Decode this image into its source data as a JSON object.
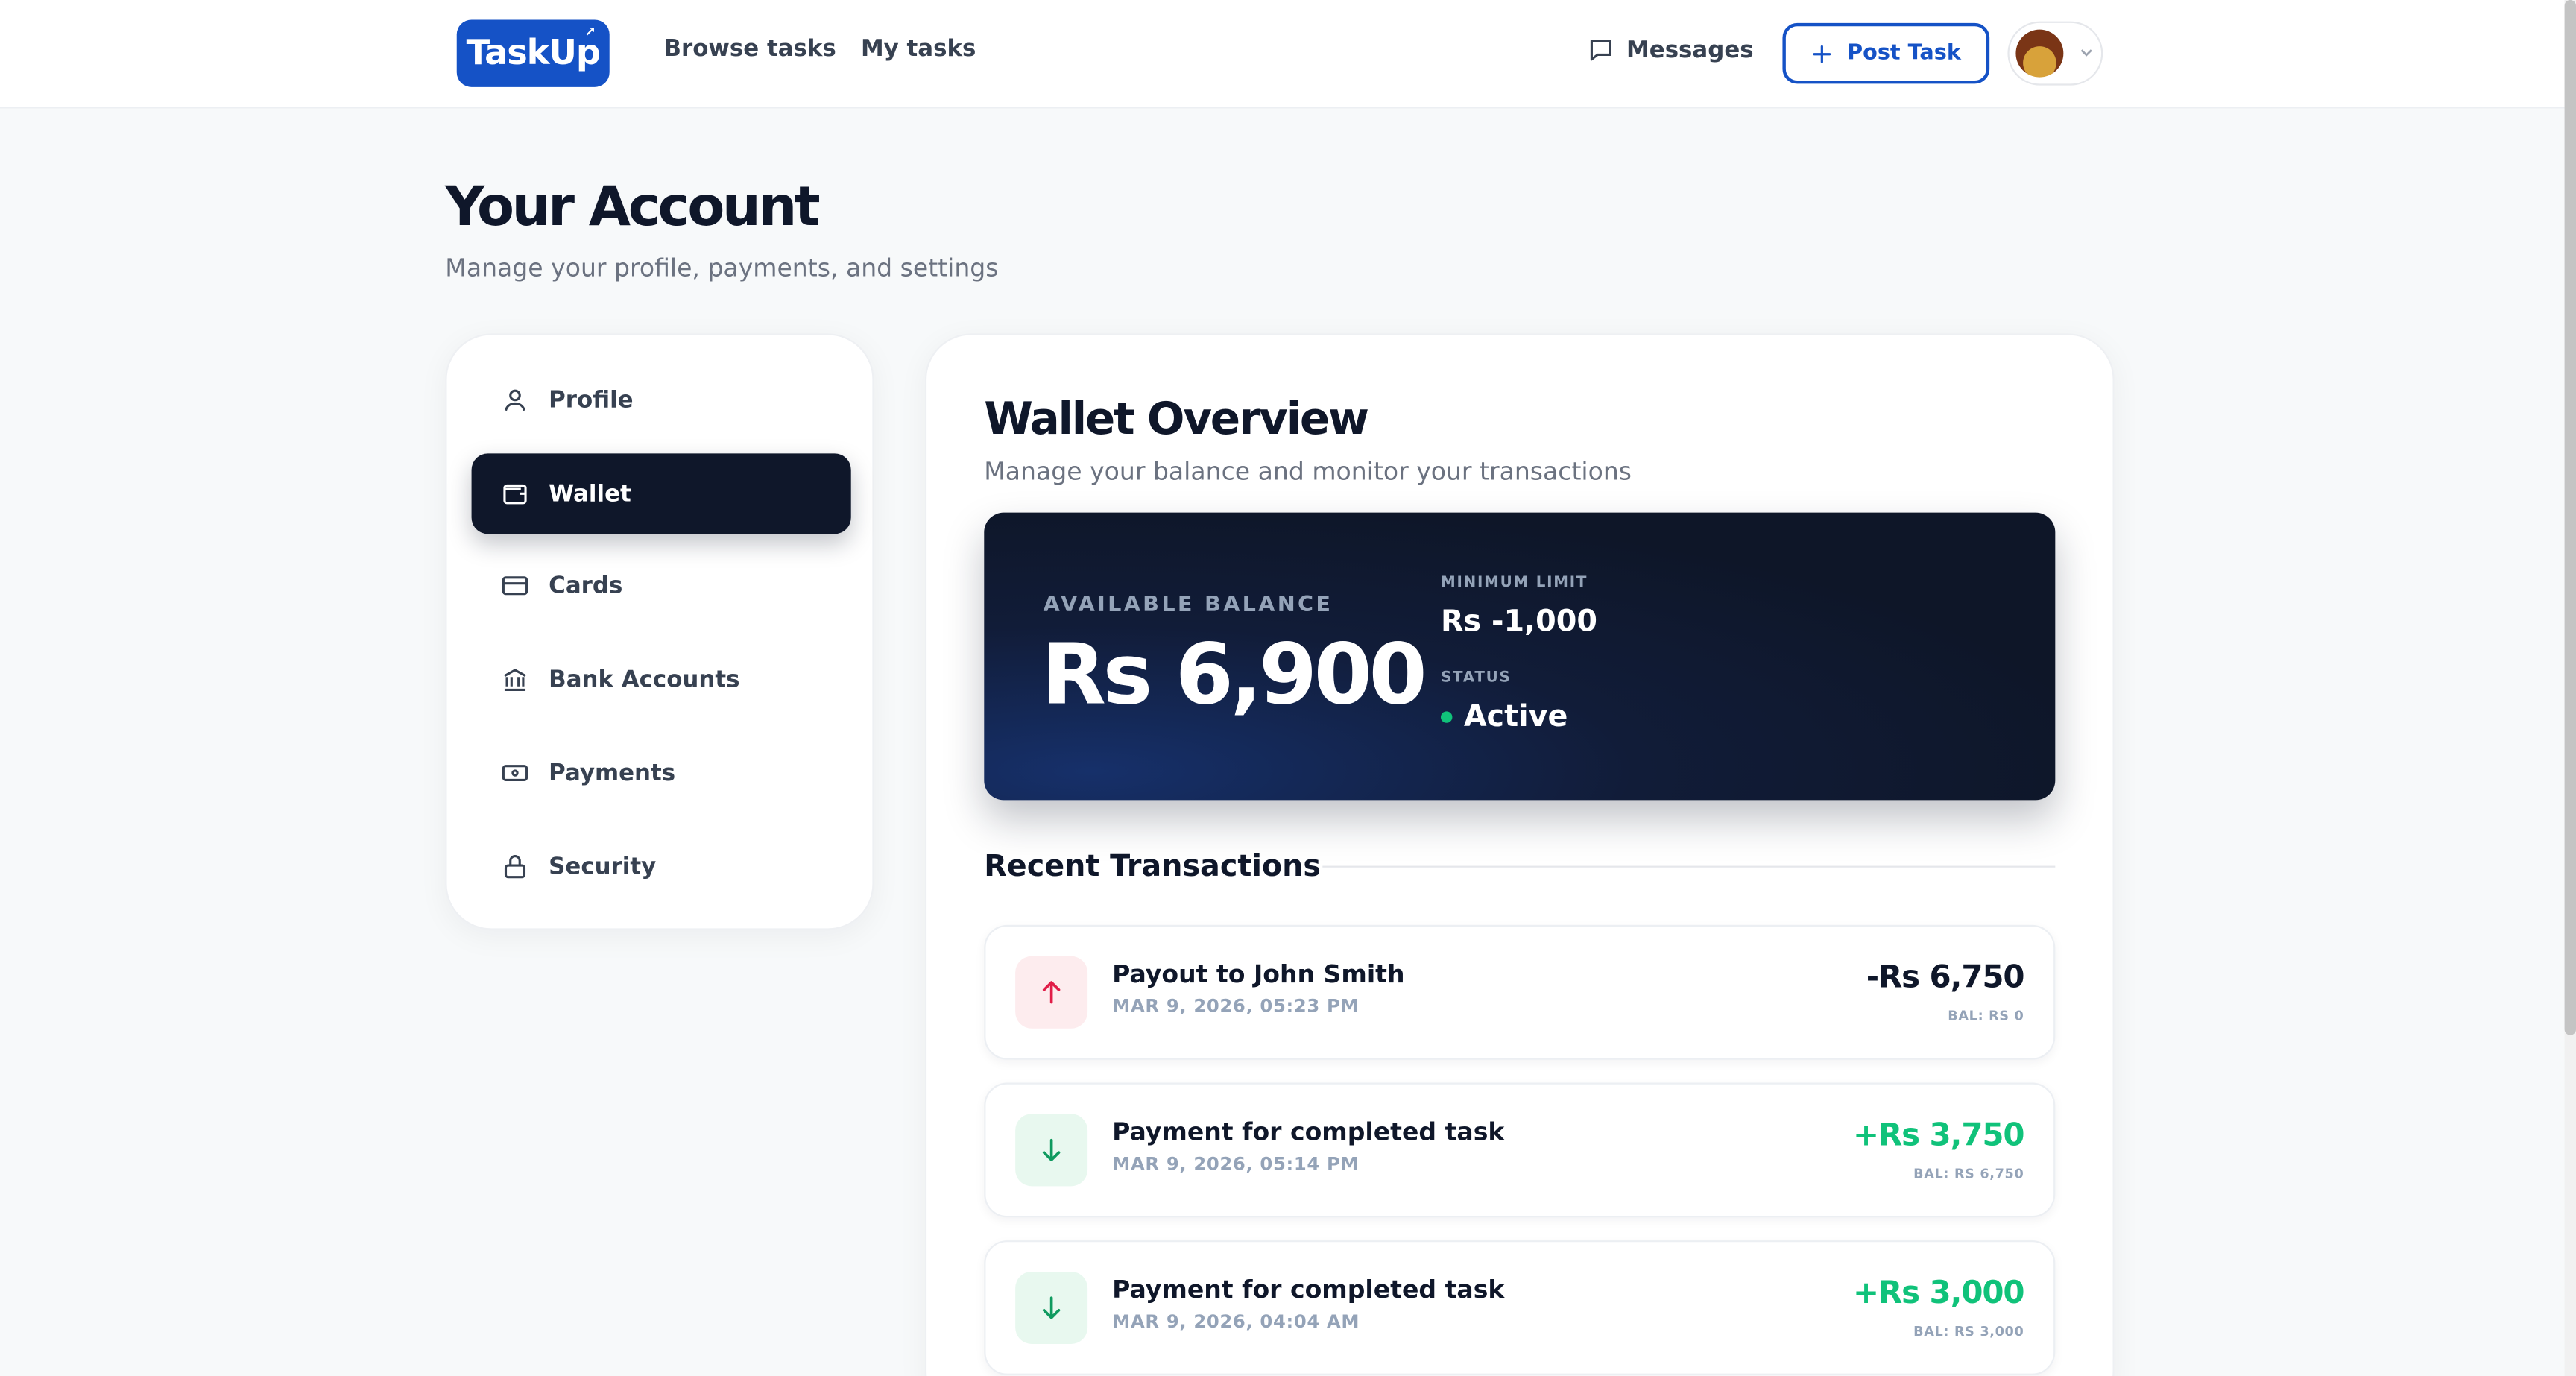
{
  "header": {
    "logo_text": "TaskUp",
    "nav": [
      "Browse tasks",
      "My tasks"
    ],
    "messages_label": "Messages",
    "post_task_label": "Post Task"
  },
  "page": {
    "title": "Your Account",
    "subtitle": "Manage your profile, payments, and settings"
  },
  "sidebar": {
    "items": [
      {
        "label": "Profile",
        "icon": "user-icon",
        "active": false
      },
      {
        "label": "Wallet",
        "icon": "wallet-icon",
        "active": true
      },
      {
        "label": "Cards",
        "icon": "card-icon",
        "active": false
      },
      {
        "label": "Bank Accounts",
        "icon": "bank-icon",
        "active": false
      },
      {
        "label": "Payments",
        "icon": "banknote-icon",
        "active": false
      },
      {
        "label": "Security",
        "icon": "lock-icon",
        "active": false
      }
    ]
  },
  "wallet": {
    "title": "Wallet Overview",
    "subtitle": "Manage your balance and monitor your transactions",
    "balance_label": "AVAILABLE BALANCE",
    "balance_value": "Rs 6,900",
    "min_limit_label": "MINIMUM LIMIT",
    "min_limit_value": "Rs -1,000",
    "status_label": "STATUS",
    "status_value": "Active"
  },
  "transactions": {
    "title": "Recent Transactions",
    "items": [
      {
        "title": "Payout to John Smith",
        "date": "MAR 9, 2026, 05:23 PM",
        "amount": "-Rs 6,750",
        "balance": "BAL: RS 0",
        "direction": "out"
      },
      {
        "title": "Payment for completed task",
        "date": "MAR 9, 2026, 05:14 PM",
        "amount": "+Rs 3,750",
        "balance": "BAL: RS 6,750",
        "direction": "in"
      },
      {
        "title": "Payment for completed task",
        "date": "MAR 9, 2026, 04:04 AM",
        "amount": "+Rs 3,000",
        "balance": "BAL: RS 3,000",
        "direction": "in"
      }
    ]
  },
  "colors": {
    "brand": "#1552c6",
    "dark": "#0f172a",
    "positive": "#10c27a",
    "negative_icon": "#e11d48"
  }
}
